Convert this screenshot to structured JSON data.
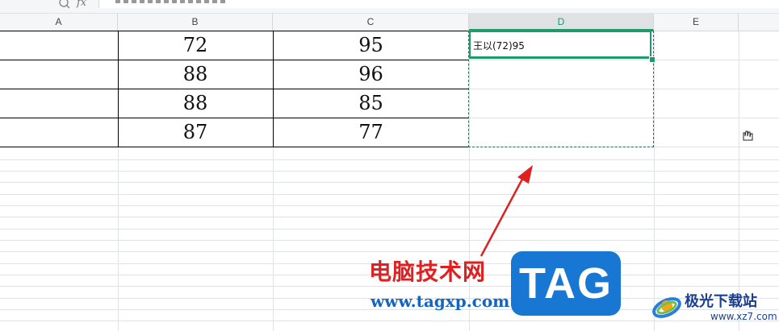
{
  "formula_bar": {
    "fx_label": "fx"
  },
  "columns": [
    "A",
    "B",
    "C",
    "D",
    "E"
  ],
  "active_column": "D",
  "rows": [
    {
      "b": "72",
      "c": "95"
    },
    {
      "b": "88",
      "c": "96"
    },
    {
      "b": "88",
      "c": "85"
    },
    {
      "b": "87",
      "c": "77"
    }
  ],
  "selected_cell": {
    "ref": "D1",
    "value": "王以(72)95"
  },
  "colors": {
    "selection": "#1e9b6b",
    "annotation_arrow": "#e02020"
  },
  "watermark": {
    "site_name": "电脑技术网",
    "url": "www.tagxp.com",
    "tag": "TAG",
    "site_name_2": "极光下载站",
    "url_2": "www.xz7.com"
  }
}
